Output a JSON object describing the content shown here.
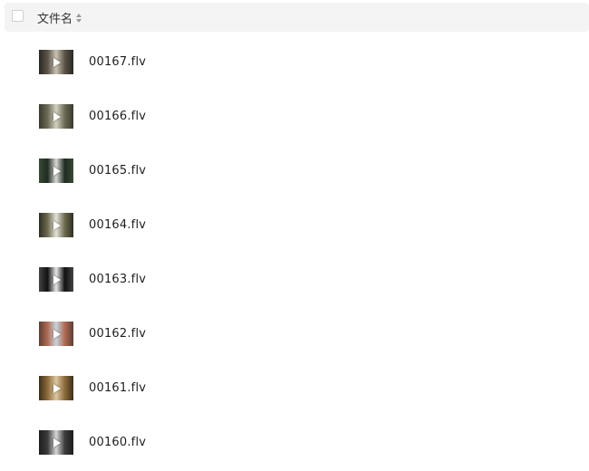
{
  "header": {
    "column_title": "文件名"
  },
  "files": [
    {
      "name": "00167.flv",
      "thumb_colors": [
        "#5a5347",
        "#c9c2b2",
        "#2a2823"
      ]
    },
    {
      "name": "00166.flv",
      "thumb_colors": [
        "#6b6a55",
        "#d2d0bf",
        "#3b3a2c"
      ]
    },
    {
      "name": "00165.flv",
      "thumb_colors": [
        "#1e2b20",
        "#d9d9d4",
        "#3a4a36"
      ]
    },
    {
      "name": "00164.flv",
      "thumb_colors": [
        "#6d6a4f",
        "#e3e2d8",
        "#2f2e22"
      ]
    },
    {
      "name": "00163.flv",
      "thumb_colors": [
        "#111111",
        "#e8e8e8",
        "#444444"
      ]
    },
    {
      "name": "00162.flv",
      "thumb_colors": [
        "#b06a52",
        "#c7d3dc",
        "#5c3e35"
      ]
    },
    {
      "name": "00161.flv",
      "thumb_colors": [
        "#8c6a3a",
        "#dcc7a0",
        "#3d2f1d"
      ]
    },
    {
      "name": "00160.flv",
      "thumb_colors": [
        "#3b3b3b",
        "#d6d6d6",
        "#1d1d1d"
      ]
    }
  ]
}
